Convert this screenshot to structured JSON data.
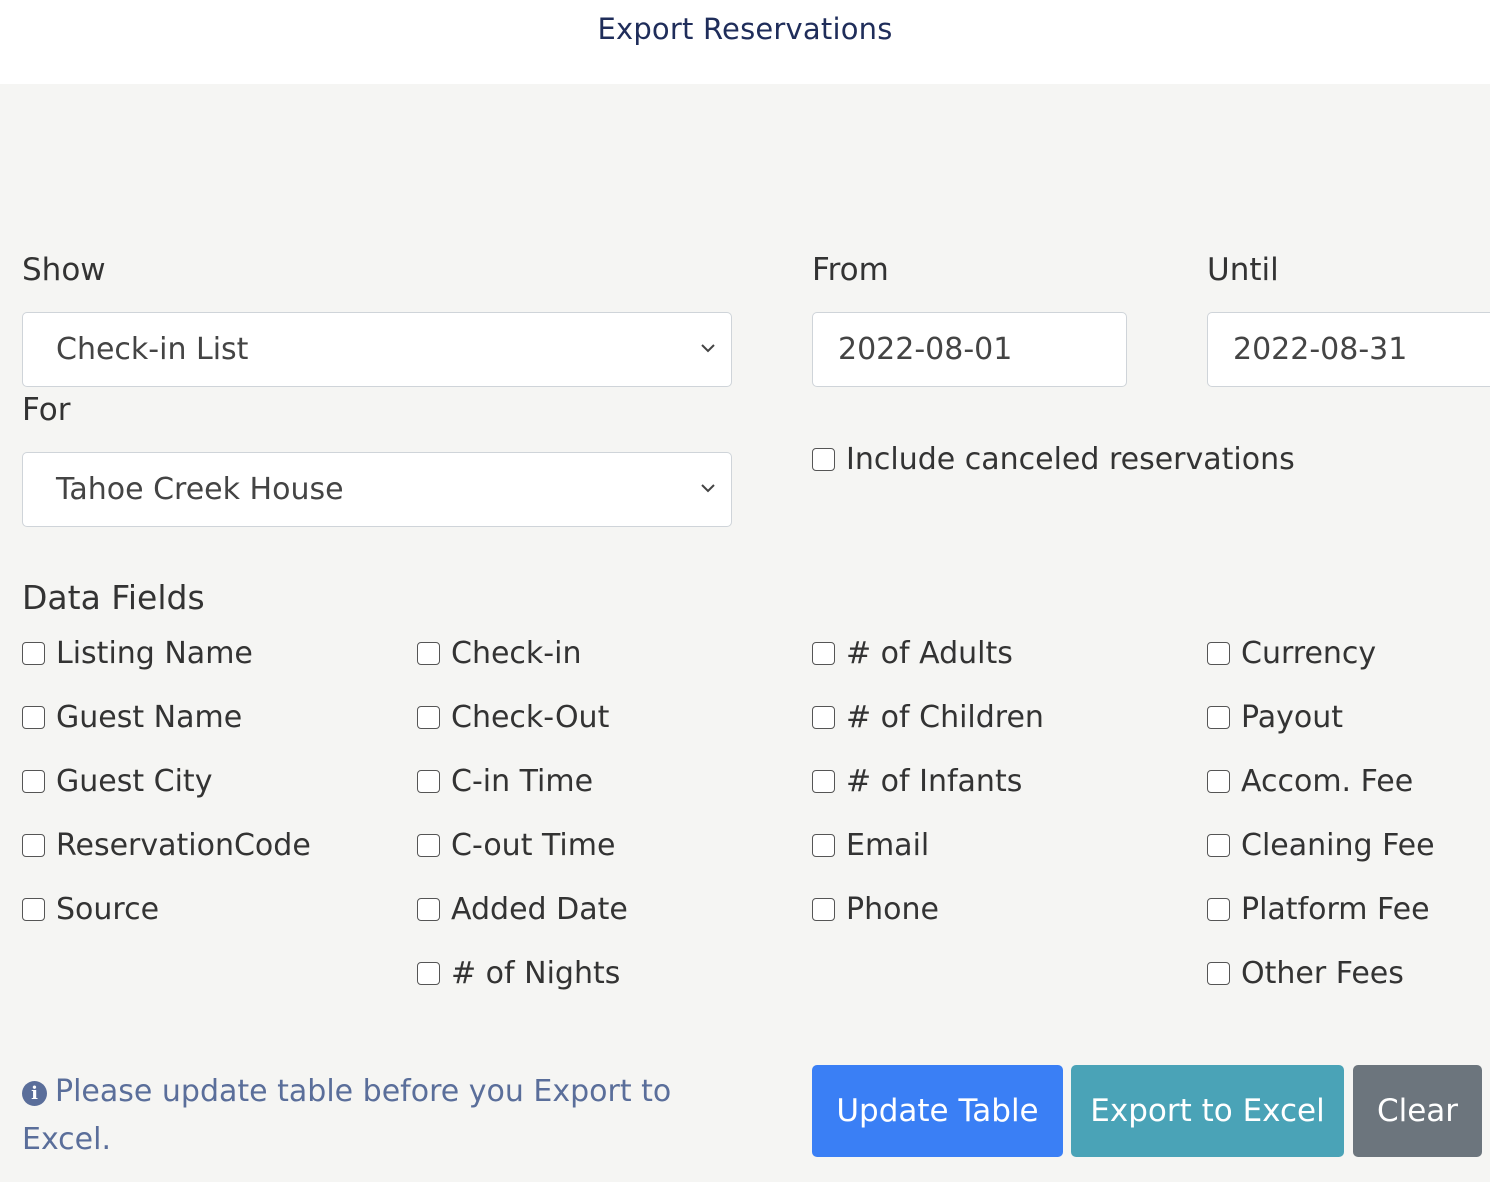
{
  "header": {
    "title": "Export Reservations"
  },
  "filters": {
    "show_label": "Show",
    "show_value": "Check-in List",
    "for_label": "For",
    "for_value": "Tahoe Creek House",
    "from_label": "From",
    "from_value": "2022-08-01",
    "until_label": "Until",
    "until_value": "2022-08-31",
    "include_canceled_label": "Include canceled reservations"
  },
  "data_fields": {
    "title": "Data Fields",
    "columns": [
      [
        "Listing Name",
        "Guest Name",
        "Guest City",
        "ReservationCode",
        "Source"
      ],
      [
        "Check-in",
        "Check-Out",
        "C-in Time",
        "C-out Time",
        "Added Date",
        "# of Nights"
      ],
      [
        "# of Adults",
        "# of Children",
        "# of Infants",
        "Email",
        "Phone"
      ],
      [
        "Currency",
        "Payout",
        "Accom. Fee",
        "Cleaning Fee",
        "Platform Fee",
        "Other Fees"
      ]
    ]
  },
  "footer": {
    "note": "Please update table before you Export to Excel.",
    "update_label": "Update Table",
    "export_label": "Export to Excel",
    "clear_label": "Clear"
  },
  "icons": {
    "info": "info-circle-icon",
    "chevron": "chevron-down-icon"
  },
  "colors": {
    "primary": "#3a7ff5",
    "info": "#4aa3b7",
    "secondary": "#6c757d",
    "title": "#1f2d5a",
    "note": "#5a6e9a"
  }
}
